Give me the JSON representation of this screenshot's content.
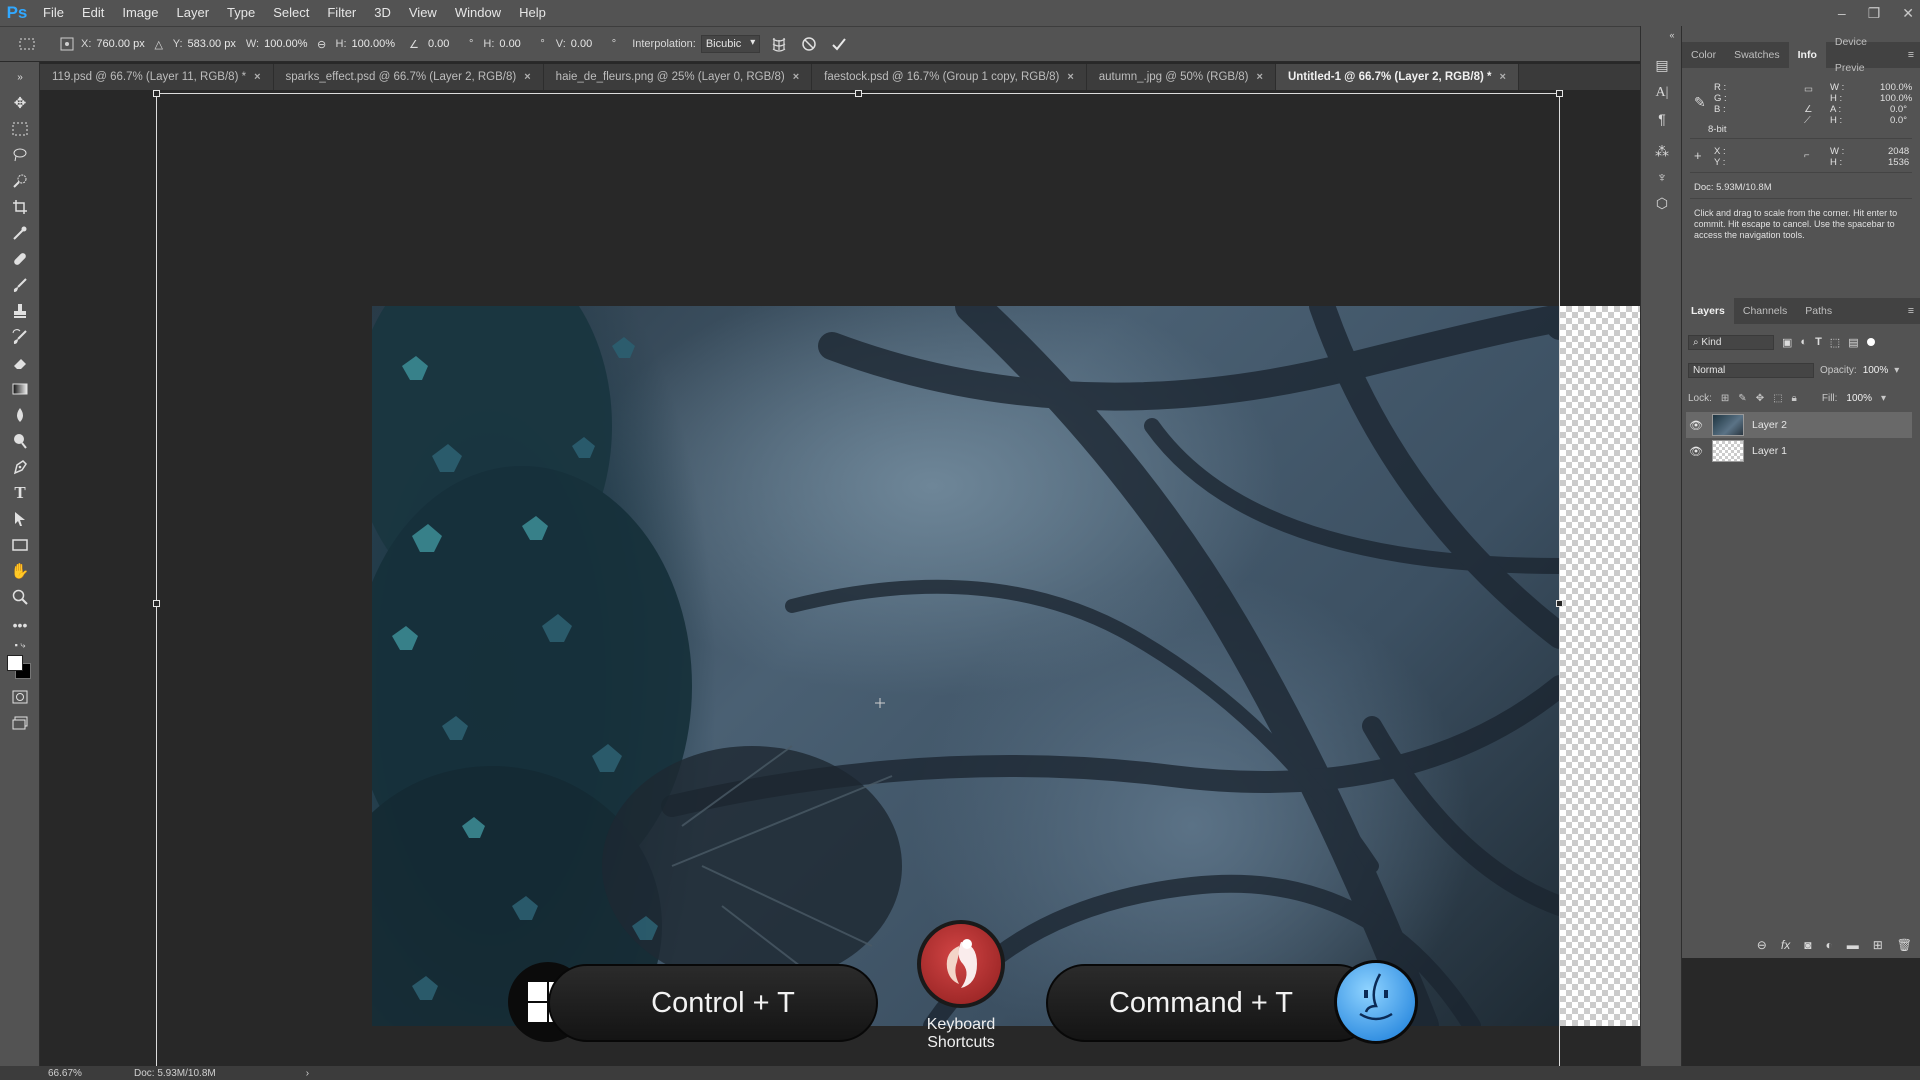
{
  "app": {
    "logo": "Ps"
  },
  "menu": [
    "File",
    "Edit",
    "Image",
    "Layer",
    "Type",
    "Select",
    "Filter",
    "3D",
    "View",
    "Window",
    "Help"
  ],
  "window_controls": {
    "minimize": "–",
    "restore": "❐",
    "close": "✕"
  },
  "options": {
    "x_label": "X:",
    "x_value": "760.00 px",
    "y_label": "Y:",
    "y_value": "583.00 px",
    "w_label": "W:",
    "w_value": "100.00%",
    "h_label": "H:",
    "h_value": "100.00%",
    "angle_value": "0.00",
    "angle_unit": "°",
    "hskew_label": "H:",
    "hskew_value": "0.00",
    "vskew_label": "V:",
    "vskew_value": "0.00",
    "interp_label": "Interpolation:",
    "interp_value": "Bicubic"
  },
  "tabs": [
    {
      "label": "119.psd @ 66.7% (Layer 11, RGB/8) *",
      "active": false
    },
    {
      "label": "sparks_effect.psd @ 66.7% (Layer 2, RGB/8)",
      "active": false
    },
    {
      "label": "haie_de_fleurs.png @ 25% (Layer 0, RGB/8)",
      "active": false
    },
    {
      "label": "faestock.psd @ 16.7% (Group 1 copy, RGB/8)",
      "active": false
    },
    {
      "label": "autumn_.jpg @ 50% (RGB/8)",
      "active": false
    },
    {
      "label": "Untitled-1 @ 66.7% (Layer 2, RGB/8) *",
      "active": true
    }
  ],
  "tab_close": "×",
  "info_panel": {
    "tabs": [
      "Color",
      "Swatches",
      "Info",
      "Device Previe"
    ],
    "active_tab": "Info",
    "rgb": {
      "r": "R :",
      "g": "G :",
      "b": "B :"
    },
    "bit_depth": "8-bit",
    "wh_pct": {
      "w_label": "W :",
      "w_value": "100.0%",
      "h_label": "H :",
      "h_value": "100.0%",
      "a_label": "A :",
      "a_value": "0.0°",
      "h2_label": "H :",
      "h2_value": "0.0°"
    },
    "xy": {
      "x": "X :",
      "y": "Y :"
    },
    "size": {
      "w_label": "W :",
      "w_value": "2048",
      "h_label": "H :",
      "h_value": "1536"
    },
    "doc": "Doc: 5.93M/10.8M",
    "hint": "Click and drag to scale from the corner. Hit enter to commit. Hit escape to cancel. Use the spacebar to access the navigation tools."
  },
  "layers_panel": {
    "tabs": [
      "Layers",
      "Channels",
      "Paths"
    ],
    "active_tab": "Layers",
    "filter_kind": "Kind",
    "blend_mode": "Normal",
    "opacity_label": "Opacity:",
    "opacity_value": "100%",
    "lock_label": "Lock:",
    "fill_label": "Fill:",
    "fill_value": "100%",
    "layers": [
      {
        "name": "Layer 2",
        "selected": true
      },
      {
        "name": "Layer 1",
        "selected": false
      }
    ]
  },
  "status": {
    "zoom": "66.67%",
    "doc": "Doc: 5.93M/10.8M"
  },
  "banner": {
    "windows_shortcut": "Control + T",
    "brand_label": "Keyboard Shortcuts",
    "mac_shortcut": "Command + T"
  }
}
